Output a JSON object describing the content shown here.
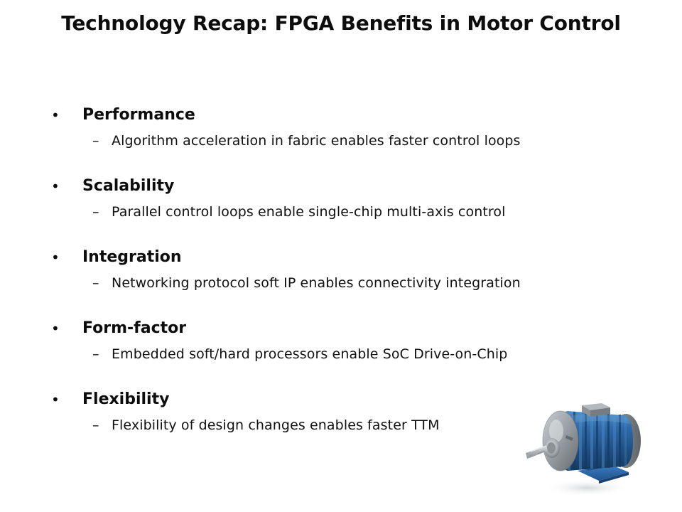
{
  "slide": {
    "title": "Technology Recap: FPGA Benefits in Motor Control",
    "background_color": "#ffffff",
    "text_color": "#0d0d0d",
    "bullet_marker": "•",
    "sub_marker": "–",
    "bullets": [
      {
        "title": "Performance",
        "sub": "Algorithm acceleration in fabric enables faster control loops"
      },
      {
        "title": "Scalability",
        "sub": "Parallel control loops enable single-chip multi-axis control"
      },
      {
        "title": "Integration",
        "sub": "Networking protocol soft IP enables connectivity integration"
      },
      {
        "title": "Form-factor",
        "sub": "Embedded soft/hard processors enable SoC Drive-on-Chip"
      },
      {
        "title": "Flexibility",
        "sub": "Flexibility of design changes enables faster TTM"
      }
    ]
  },
  "figure": {
    "name": "industrial-electric-motor",
    "colors": {
      "body_blue": "#2a5d96",
      "body_blue_dark": "#173f6b",
      "body_blue_light": "#3f7cba",
      "foot_blue": "#2f6bb5",
      "endbell_gray": "#9aa0a4",
      "endbell_gray_dark": "#71777b",
      "shaft_silver": "#c6cace",
      "terminal_box_gray": "#8d9296",
      "shadow": "#d9dbdd"
    }
  }
}
